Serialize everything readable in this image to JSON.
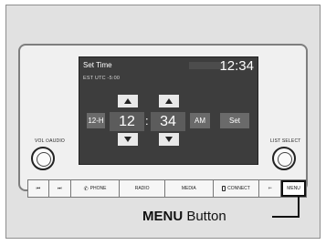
{
  "screen": {
    "title": "Set Time",
    "clock": "12:34",
    "timezone": "EST  UTC  -5:00",
    "format_button": "12-H",
    "hour": "12",
    "separator": ":",
    "minute": "34",
    "ampm_button": "AM",
    "set_button": "Set"
  },
  "knobs": {
    "left_label": "VOL  ⏻AUDIO",
    "right_label": "LIST  SELECT"
  },
  "buttons": {
    "skip_back": "⏮",
    "skip_forward": "⏭",
    "phone": "PHONE",
    "radio": "RADIO",
    "media": "MEDIA",
    "connect": "CONNECT",
    "back": "⇐",
    "menu": "MENU"
  },
  "callout": {
    "bold": "MENU",
    "rest": " Button"
  }
}
